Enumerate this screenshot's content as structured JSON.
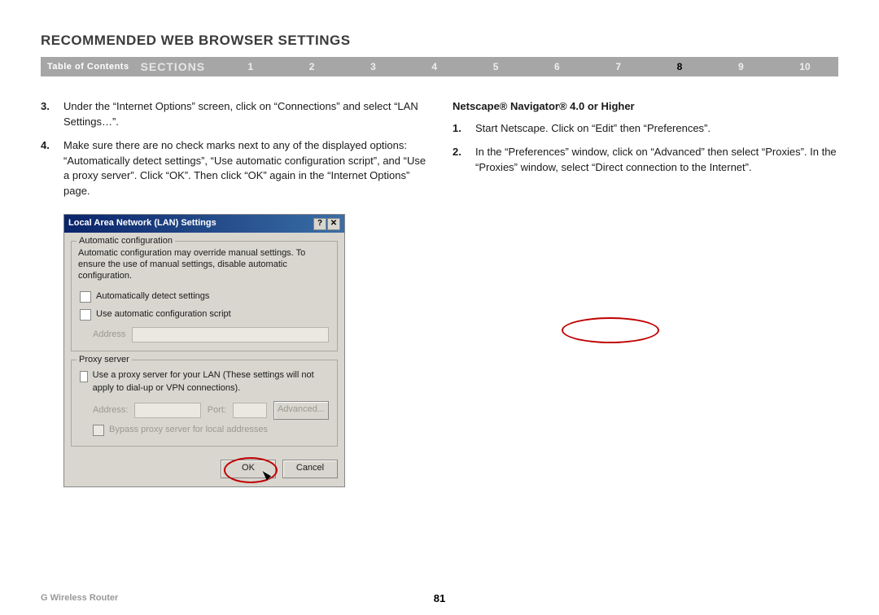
{
  "title": "RECOMMENDED WEB BROWSER SETTINGS",
  "nav": {
    "toc": "Table of Contents",
    "sections": "SECTIONS",
    "nums": [
      "1",
      "2",
      "3",
      "4",
      "5",
      "6",
      "7",
      "8",
      "9",
      "10"
    ],
    "active": "8"
  },
  "left": {
    "step3num": "3.",
    "step3": "Under the “Internet Options” screen, click on “Connections” and select “LAN Settings…”.",
    "step4num": "4.",
    "step4": "Make sure there are no check marks next to any of the displayed options: “Automatically detect settings”, “Use automatic configuration script”, and “Use a proxy server”. Click “OK”. Then click “OK” again in the “Internet Options” page."
  },
  "dialog": {
    "title": "Local Area Network (LAN) Settings",
    "help_btn": "?",
    "close_btn": "✕",
    "auto_legend": "Automatic configuration",
    "auto_help": "Automatic configuration may override manual settings. To ensure the use of manual settings, disable automatic configuration.",
    "chk_detect": "Automatically detect settings",
    "chk_script": "Use automatic configuration script",
    "address_lbl": "Address",
    "proxy_legend": "Proxy server",
    "proxy_text": "Use a proxy server for your LAN (These settings will not apply to dial-up or VPN connections).",
    "addr2": "Address:",
    "port": "Port:",
    "advanced": "Advanced...",
    "bypass": "Bypass proxy server for local addresses",
    "ok": "OK",
    "cancel": "Cancel"
  },
  "right": {
    "heading": "Netscape® Navigator® 4.0 or Higher",
    "s1n": "1.",
    "s1": "Start Netscape. Click on “Edit” then “Preferences”.",
    "s2n": "2.",
    "s2": "In the “Preferences” window, click on “Advanced” then select “Proxies”. In the “Proxies” window, select “Direct connection to the Internet”."
  },
  "footer": {
    "product": "G Wireless Router",
    "page": "81"
  }
}
